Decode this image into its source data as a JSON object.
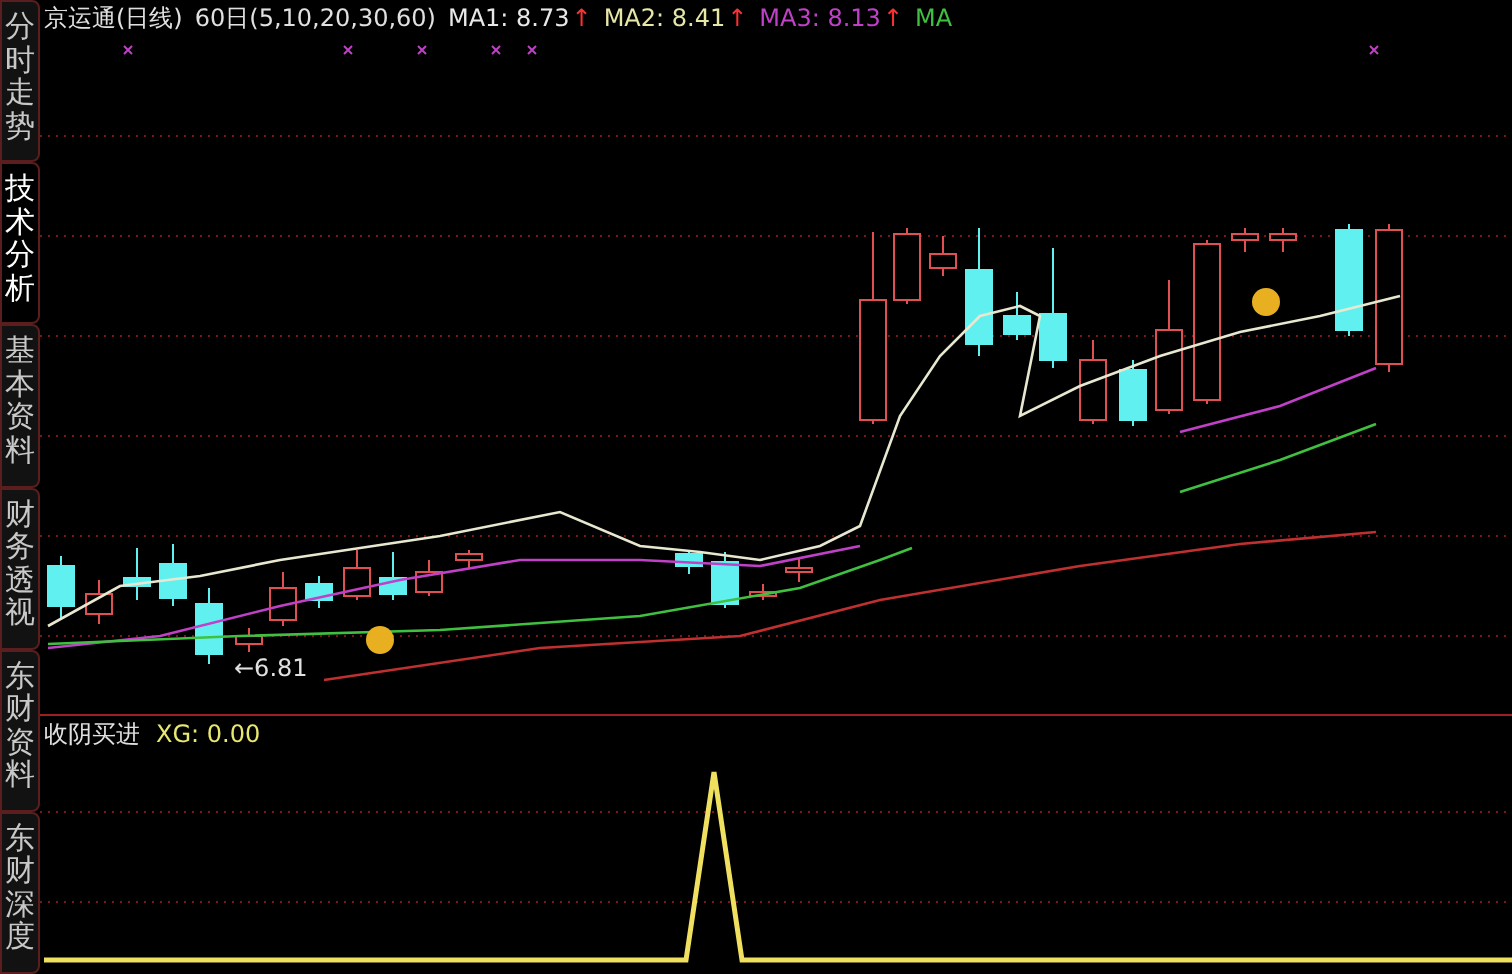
{
  "side_tabs": [
    {
      "label": "分时走势",
      "selected": false
    },
    {
      "label": "技术分析",
      "selected": true
    },
    {
      "label": "基本资料",
      "selected": false
    },
    {
      "label": "财务透视",
      "selected": false
    },
    {
      "label": "东财资料",
      "selected": false
    },
    {
      "label": "东财深度",
      "selected": false
    }
  ],
  "chart": {
    "title": "京运通(日线)",
    "period": "60日(5,10,20,30,60)",
    "averages": [
      {
        "label": "MA1: 8.73",
        "arrow": "↑",
        "color": "#e8e8e8"
      },
      {
        "label": "MA2: 8.41",
        "arrow": "↑",
        "color": "#e6e6a8"
      },
      {
        "label": "MA3: 8.13",
        "arrow": "↑",
        "color": "#c040c8"
      },
      {
        "label": "MA",
        "color": "#40c040"
      }
    ],
    "low_marker": "←6.81"
  },
  "indicator": {
    "name": "收阴买进",
    "reading": "XG: 0.00"
  }
}
